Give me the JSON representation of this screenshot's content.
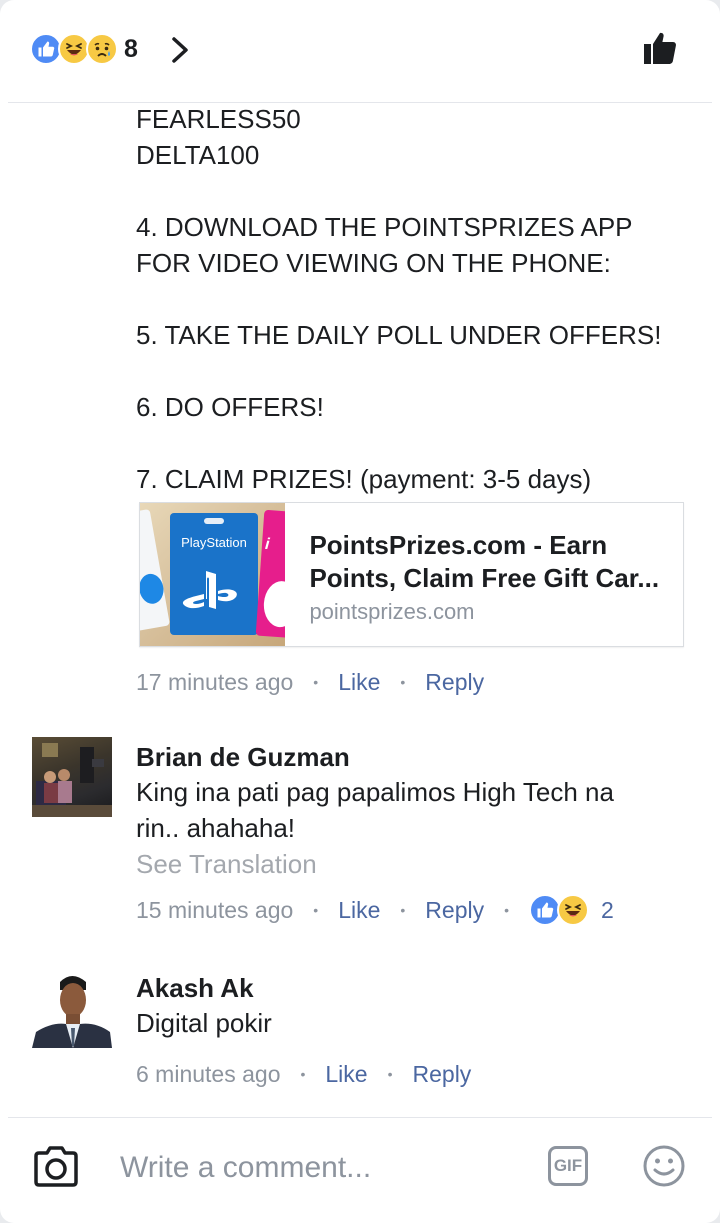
{
  "header": {
    "reaction_count": "8",
    "reaction_icons": [
      "like-icon",
      "haha-icon",
      "sad-icon"
    ]
  },
  "post": {
    "lines": [
      "FEARLESS50",
      "DELTA100",
      "",
      "4. DOWNLOAD THE POINTSPRIZES APP",
      "FOR VIDEO VIEWING ON THE PHONE:",
      "",
      "5. TAKE THE DAILY POLL UNDER OFFERS!",
      "",
      "6. DO OFFERS!",
      "",
      "7. CLAIM PRIZES! (payment: 3-5 days)"
    ],
    "link": {
      "thumb_label": "PlayStation",
      "title_line1": "PointsPrizes.com - Earn",
      "title_line2": "Points, Claim Free Gift Car...",
      "domain": "pointsprizes.com"
    },
    "meta": {
      "time": "17 minutes ago",
      "like": "Like",
      "reply": "Reply"
    }
  },
  "comments": [
    {
      "name": "Brian de Guzman",
      "text_line1": "King ina pati pag papalimos High Tech na",
      "text_line2": "rin.. ahahaha!",
      "see_translation": "See Translation",
      "meta": {
        "time": "15 minutes ago",
        "like": "Like",
        "reply": "Reply",
        "reaction_count": "2"
      }
    },
    {
      "name": "Akash Ak",
      "text_line1": "Digital pokir",
      "meta": {
        "time": "6 minutes ago",
        "like": "Like",
        "reply": "Reply"
      }
    }
  ],
  "composer": {
    "placeholder": "Write a comment...",
    "gif_label": "GIF"
  },
  "colors": {
    "link_blue": "#4b67a1",
    "muted_gray": "#8d949e",
    "like_blue": "#4f8bf5",
    "emoji_yellow": "#f7c944"
  }
}
